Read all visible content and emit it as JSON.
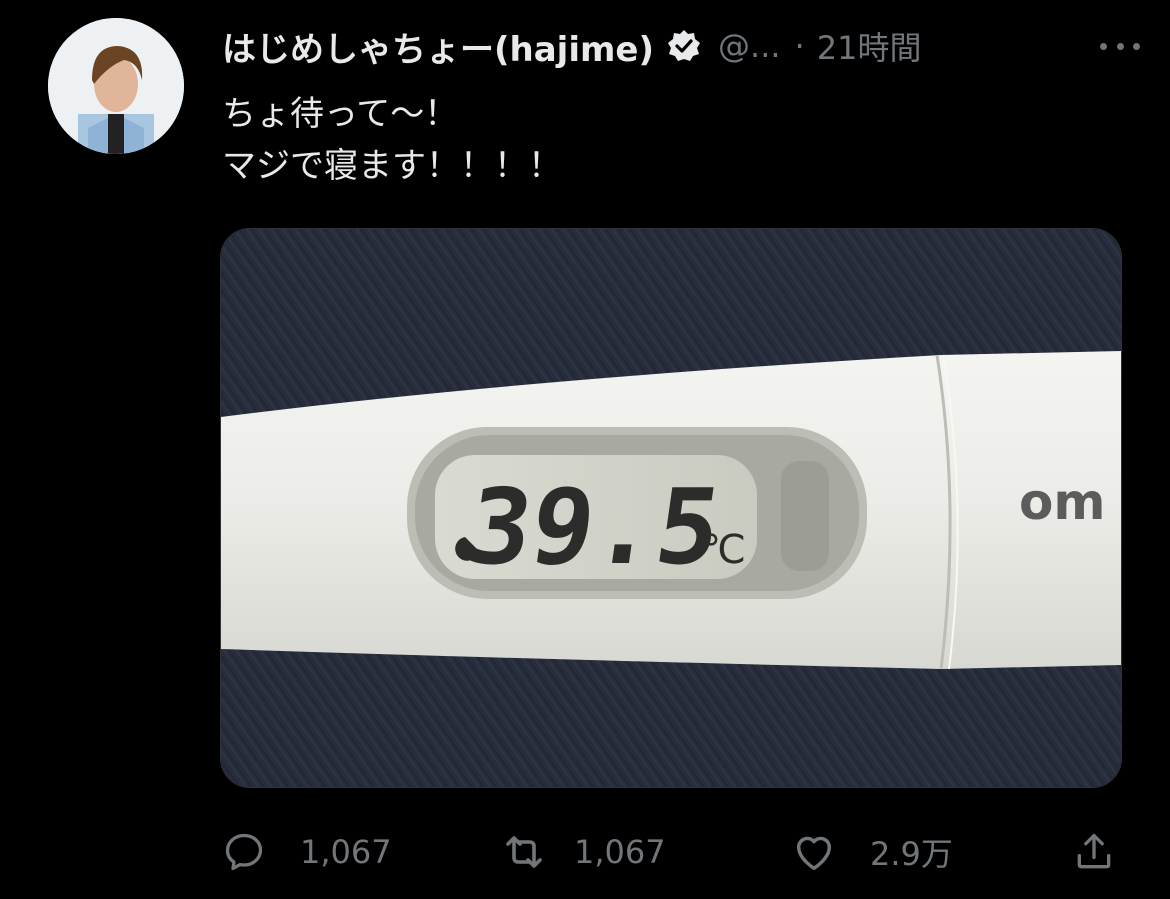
{
  "tweet": {
    "display_name": "はじめしゃちょー(hajime)",
    "handle": "@...",
    "separator": "·",
    "time": "21時間",
    "text_lines": [
      "ちょ待って〜！",
      "マジで寝ます！！！！"
    ]
  },
  "media": {
    "thermometer_reading": "39.5",
    "unit": "℃",
    "brand_text": "om"
  },
  "actions": {
    "reply_count": "1,067",
    "retweet_count": "1,067",
    "like_count": "2.9万"
  },
  "colors": {
    "background": "#000000",
    "primary_text": "#e7e9ea",
    "secondary_text": "#71767b",
    "border": "#2f3336"
  },
  "icons": [
    "verified-badge-icon",
    "more-icon",
    "reply-icon",
    "retweet-icon",
    "like-icon",
    "share-icon"
  ]
}
